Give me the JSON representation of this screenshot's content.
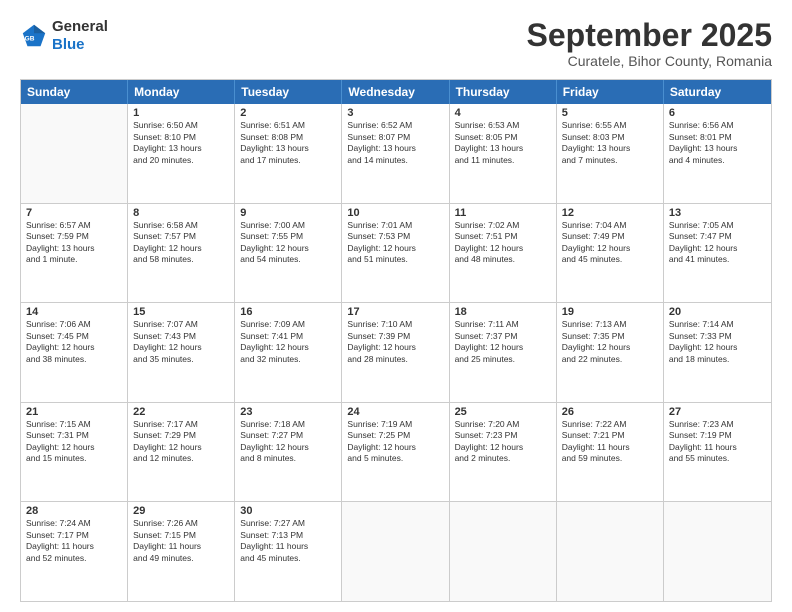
{
  "header": {
    "logo_general": "General",
    "logo_blue": "Blue",
    "month_title": "September 2025",
    "subtitle": "Curatele, Bihor County, Romania"
  },
  "weekdays": [
    "Sunday",
    "Monday",
    "Tuesday",
    "Wednesday",
    "Thursday",
    "Friday",
    "Saturday"
  ],
  "rows": [
    [
      {
        "day": "",
        "info": ""
      },
      {
        "day": "1",
        "info": "Sunrise: 6:50 AM\nSunset: 8:10 PM\nDaylight: 13 hours\nand 20 minutes."
      },
      {
        "day": "2",
        "info": "Sunrise: 6:51 AM\nSunset: 8:08 PM\nDaylight: 13 hours\nand 17 minutes."
      },
      {
        "day": "3",
        "info": "Sunrise: 6:52 AM\nSunset: 8:07 PM\nDaylight: 13 hours\nand 14 minutes."
      },
      {
        "day": "4",
        "info": "Sunrise: 6:53 AM\nSunset: 8:05 PM\nDaylight: 13 hours\nand 11 minutes."
      },
      {
        "day": "5",
        "info": "Sunrise: 6:55 AM\nSunset: 8:03 PM\nDaylight: 13 hours\nand 7 minutes."
      },
      {
        "day": "6",
        "info": "Sunrise: 6:56 AM\nSunset: 8:01 PM\nDaylight: 13 hours\nand 4 minutes."
      }
    ],
    [
      {
        "day": "7",
        "info": "Sunrise: 6:57 AM\nSunset: 7:59 PM\nDaylight: 13 hours\nand 1 minute."
      },
      {
        "day": "8",
        "info": "Sunrise: 6:58 AM\nSunset: 7:57 PM\nDaylight: 12 hours\nand 58 minutes."
      },
      {
        "day": "9",
        "info": "Sunrise: 7:00 AM\nSunset: 7:55 PM\nDaylight: 12 hours\nand 54 minutes."
      },
      {
        "day": "10",
        "info": "Sunrise: 7:01 AM\nSunset: 7:53 PM\nDaylight: 12 hours\nand 51 minutes."
      },
      {
        "day": "11",
        "info": "Sunrise: 7:02 AM\nSunset: 7:51 PM\nDaylight: 12 hours\nand 48 minutes."
      },
      {
        "day": "12",
        "info": "Sunrise: 7:04 AM\nSunset: 7:49 PM\nDaylight: 12 hours\nand 45 minutes."
      },
      {
        "day": "13",
        "info": "Sunrise: 7:05 AM\nSunset: 7:47 PM\nDaylight: 12 hours\nand 41 minutes."
      }
    ],
    [
      {
        "day": "14",
        "info": "Sunrise: 7:06 AM\nSunset: 7:45 PM\nDaylight: 12 hours\nand 38 minutes."
      },
      {
        "day": "15",
        "info": "Sunrise: 7:07 AM\nSunset: 7:43 PM\nDaylight: 12 hours\nand 35 minutes."
      },
      {
        "day": "16",
        "info": "Sunrise: 7:09 AM\nSunset: 7:41 PM\nDaylight: 12 hours\nand 32 minutes."
      },
      {
        "day": "17",
        "info": "Sunrise: 7:10 AM\nSunset: 7:39 PM\nDaylight: 12 hours\nand 28 minutes."
      },
      {
        "day": "18",
        "info": "Sunrise: 7:11 AM\nSunset: 7:37 PM\nDaylight: 12 hours\nand 25 minutes."
      },
      {
        "day": "19",
        "info": "Sunrise: 7:13 AM\nSunset: 7:35 PM\nDaylight: 12 hours\nand 22 minutes."
      },
      {
        "day": "20",
        "info": "Sunrise: 7:14 AM\nSunset: 7:33 PM\nDaylight: 12 hours\nand 18 minutes."
      }
    ],
    [
      {
        "day": "21",
        "info": "Sunrise: 7:15 AM\nSunset: 7:31 PM\nDaylight: 12 hours\nand 15 minutes."
      },
      {
        "day": "22",
        "info": "Sunrise: 7:17 AM\nSunset: 7:29 PM\nDaylight: 12 hours\nand 12 minutes."
      },
      {
        "day": "23",
        "info": "Sunrise: 7:18 AM\nSunset: 7:27 PM\nDaylight: 12 hours\nand 8 minutes."
      },
      {
        "day": "24",
        "info": "Sunrise: 7:19 AM\nSunset: 7:25 PM\nDaylight: 12 hours\nand 5 minutes."
      },
      {
        "day": "25",
        "info": "Sunrise: 7:20 AM\nSunset: 7:23 PM\nDaylight: 12 hours\nand 2 minutes."
      },
      {
        "day": "26",
        "info": "Sunrise: 7:22 AM\nSunset: 7:21 PM\nDaylight: 11 hours\nand 59 minutes."
      },
      {
        "day": "27",
        "info": "Sunrise: 7:23 AM\nSunset: 7:19 PM\nDaylight: 11 hours\nand 55 minutes."
      }
    ],
    [
      {
        "day": "28",
        "info": "Sunrise: 7:24 AM\nSunset: 7:17 PM\nDaylight: 11 hours\nand 52 minutes."
      },
      {
        "day": "29",
        "info": "Sunrise: 7:26 AM\nSunset: 7:15 PM\nDaylight: 11 hours\nand 49 minutes."
      },
      {
        "day": "30",
        "info": "Sunrise: 7:27 AM\nSunset: 7:13 PM\nDaylight: 11 hours\nand 45 minutes."
      },
      {
        "day": "",
        "info": ""
      },
      {
        "day": "",
        "info": ""
      },
      {
        "day": "",
        "info": ""
      },
      {
        "day": "",
        "info": ""
      }
    ]
  ]
}
